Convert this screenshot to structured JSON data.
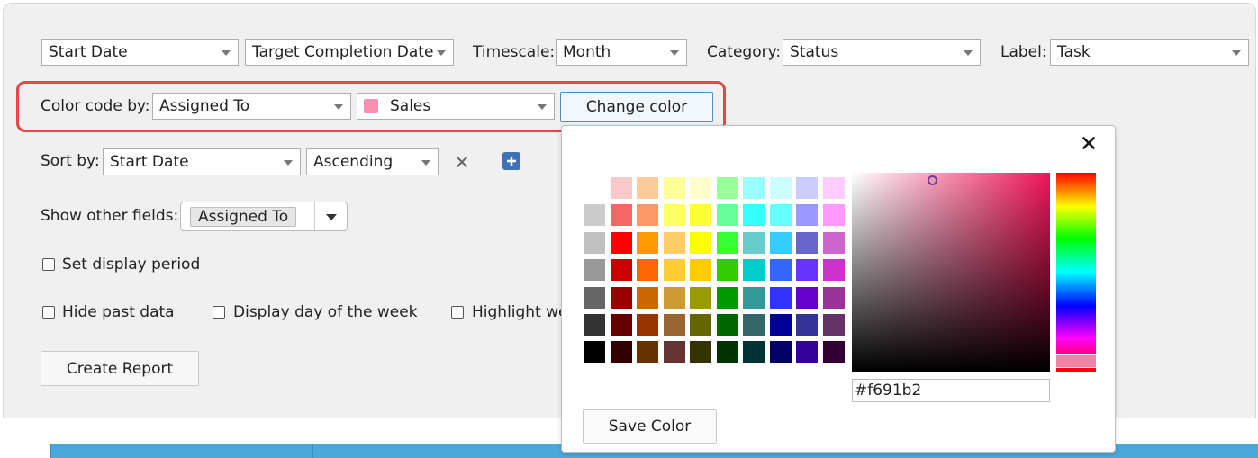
{
  "toolbar": {
    "start_field": "Start Date",
    "end_field": "Target Completion Date",
    "timescale_label": "Timescale:",
    "timescale_value": "Month",
    "category_label": "Category:",
    "category_value": "Status",
    "label_label": "Label:",
    "label_value": "Task"
  },
  "color_code": {
    "label": "Color code by:",
    "field": "Assigned To",
    "value": "Sales",
    "value_swatch_color": "#f691b2",
    "change_button": "Change color"
  },
  "sort": {
    "label": "Sort by:",
    "field": "Start Date",
    "order": "Ascending"
  },
  "other_fields": {
    "label": "Show other fields:",
    "tag": "Assigned To"
  },
  "checkboxes": {
    "display_period": "Set display period",
    "hide_past": "Hide past data",
    "day_of_week": "Display day of the week",
    "highlight": "Highlight we"
  },
  "create_button": "Create Report",
  "color_picker": {
    "hex_value": "#f691b2",
    "save_button": "Save Color",
    "close_icon": "close-icon",
    "palette": [
      [
        "#ffffff",
        "#f9c8c8",
        "#fbcb99",
        "#ffff99",
        "#ffffcc",
        "#99ff99",
        "#99ffff",
        "#ccffff",
        "#ccccff",
        "#ffccff"
      ],
      [
        "#cccccc",
        "#f66666",
        "#fd9966",
        "#ffff66",
        "#ffff33",
        "#66ff99",
        "#33ffff",
        "#66ffff",
        "#9999ff",
        "#ff99ff"
      ],
      [
        "#c0c0c0",
        "#ff0000",
        "#ff9900",
        "#ffcc66",
        "#ffff00",
        "#33ff33",
        "#66cccc",
        "#33ccff",
        "#6666cc",
        "#cc66cc"
      ],
      [
        "#999999",
        "#cc0000",
        "#ff6600",
        "#ffcc33",
        "#ffcc00",
        "#33cc00",
        "#00cccc",
        "#3366ff",
        "#6633ff",
        "#cc33cc"
      ],
      [
        "#666666",
        "#990000",
        "#cc6600",
        "#cc9933",
        "#999900",
        "#009900",
        "#339999",
        "#3333ff",
        "#6600cc",
        "#993399"
      ],
      [
        "#333333",
        "#660000",
        "#993300",
        "#996633",
        "#666600",
        "#006600",
        "#336666",
        "#000099",
        "#333399",
        "#663366"
      ],
      [
        "#000000",
        "#330000",
        "#663300",
        "#663333",
        "#333300",
        "#003300",
        "#003333",
        "#000066",
        "#330099",
        "#330033"
      ]
    ]
  }
}
